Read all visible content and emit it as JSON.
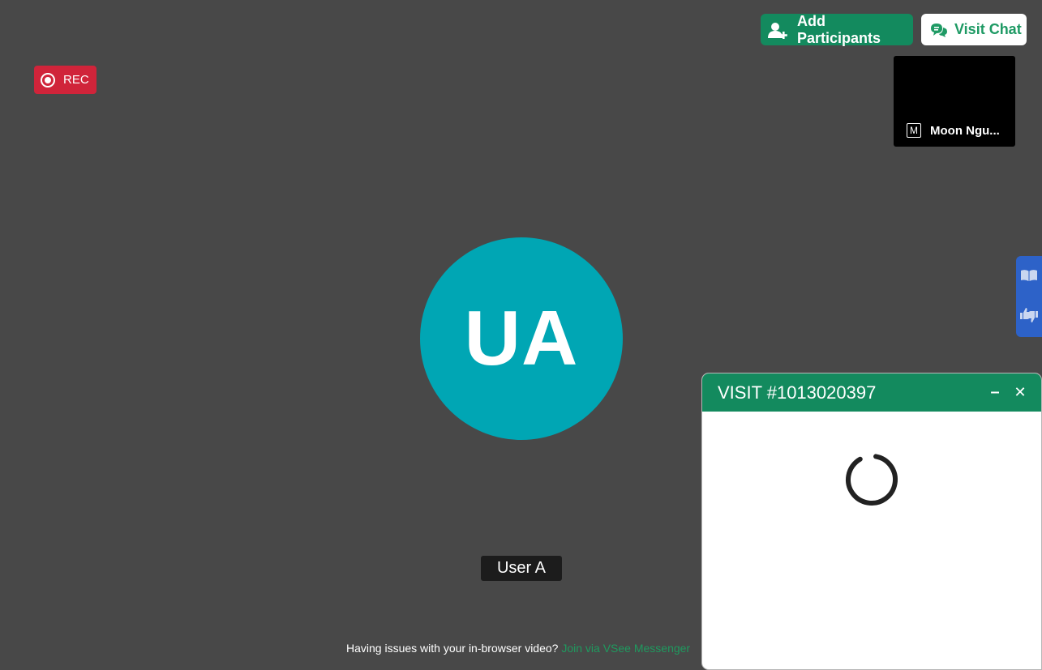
{
  "toolbar": {
    "add_participants_label": "Add Participants",
    "visit_chat_label": "Visit Chat"
  },
  "recording": {
    "label": "REC",
    "color": "#d0243a"
  },
  "participant_tile": {
    "initial": "M",
    "name": "Moon Ngu..."
  },
  "main_video": {
    "initials": "UA",
    "name": "User A",
    "avatar_color": "#00a6b4"
  },
  "footer": {
    "text": "Having issues with your in-browser video?",
    "link_text": "Join via VSee Messenger"
  },
  "visit_panel": {
    "title": "VISIT #1013020397",
    "minimize": "–",
    "close": "✕",
    "accent_color": "#138a5e"
  },
  "side_tab": {
    "icons": [
      "book-icon",
      "thumbs-up-down-icon"
    ]
  }
}
